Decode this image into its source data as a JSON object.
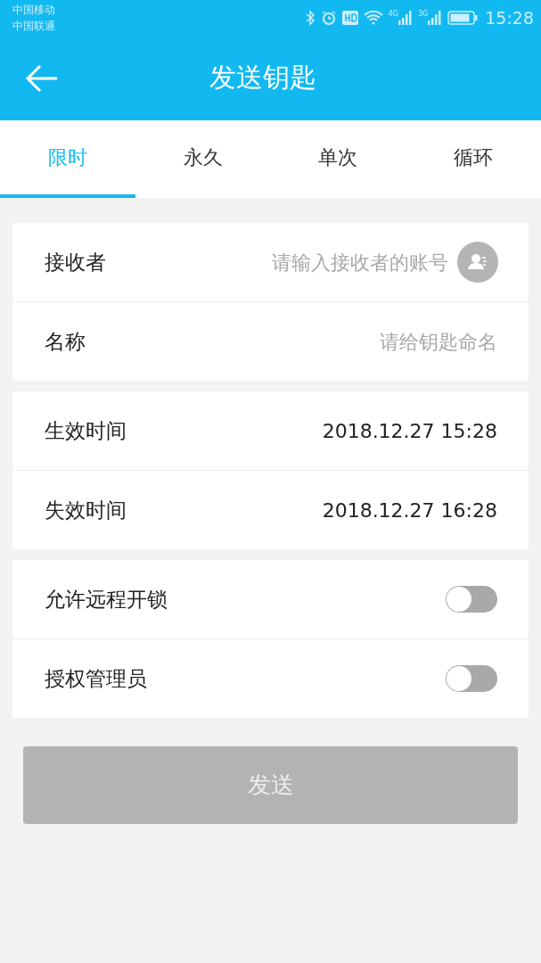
{
  "status_bar": {
    "carriers": [
      "中国移动",
      "中国联通"
    ],
    "network_labels": [
      "4G",
      "3G"
    ],
    "time": "15:28"
  },
  "header": {
    "title": "发送钥匙"
  },
  "tabs": [
    {
      "label": "限时",
      "selected": true
    },
    {
      "label": "永久",
      "selected": false
    },
    {
      "label": "单次",
      "selected": false
    },
    {
      "label": "循环",
      "selected": false
    }
  ],
  "sections": [
    {
      "rows": [
        {
          "kind": "input",
          "label": "接收者",
          "placeholder": "请输入接收者的账号",
          "contact_button": true
        },
        {
          "kind": "input",
          "label": "名称",
          "placeholder": "请给钥匙命名",
          "contact_button": false
        }
      ]
    },
    {
      "rows": [
        {
          "kind": "value",
          "label": "生效时间",
          "value": "2018.12.27 15:28"
        },
        {
          "kind": "value",
          "label": "失效时间",
          "value": "2018.12.27 16:28"
        }
      ]
    },
    {
      "rows": [
        {
          "kind": "switch",
          "label": "允许远程开锁",
          "on": false
        },
        {
          "kind": "switch",
          "label": "授权管理员",
          "on": false
        }
      ]
    }
  ],
  "send_button": {
    "label": "发送",
    "disabled": true
  }
}
